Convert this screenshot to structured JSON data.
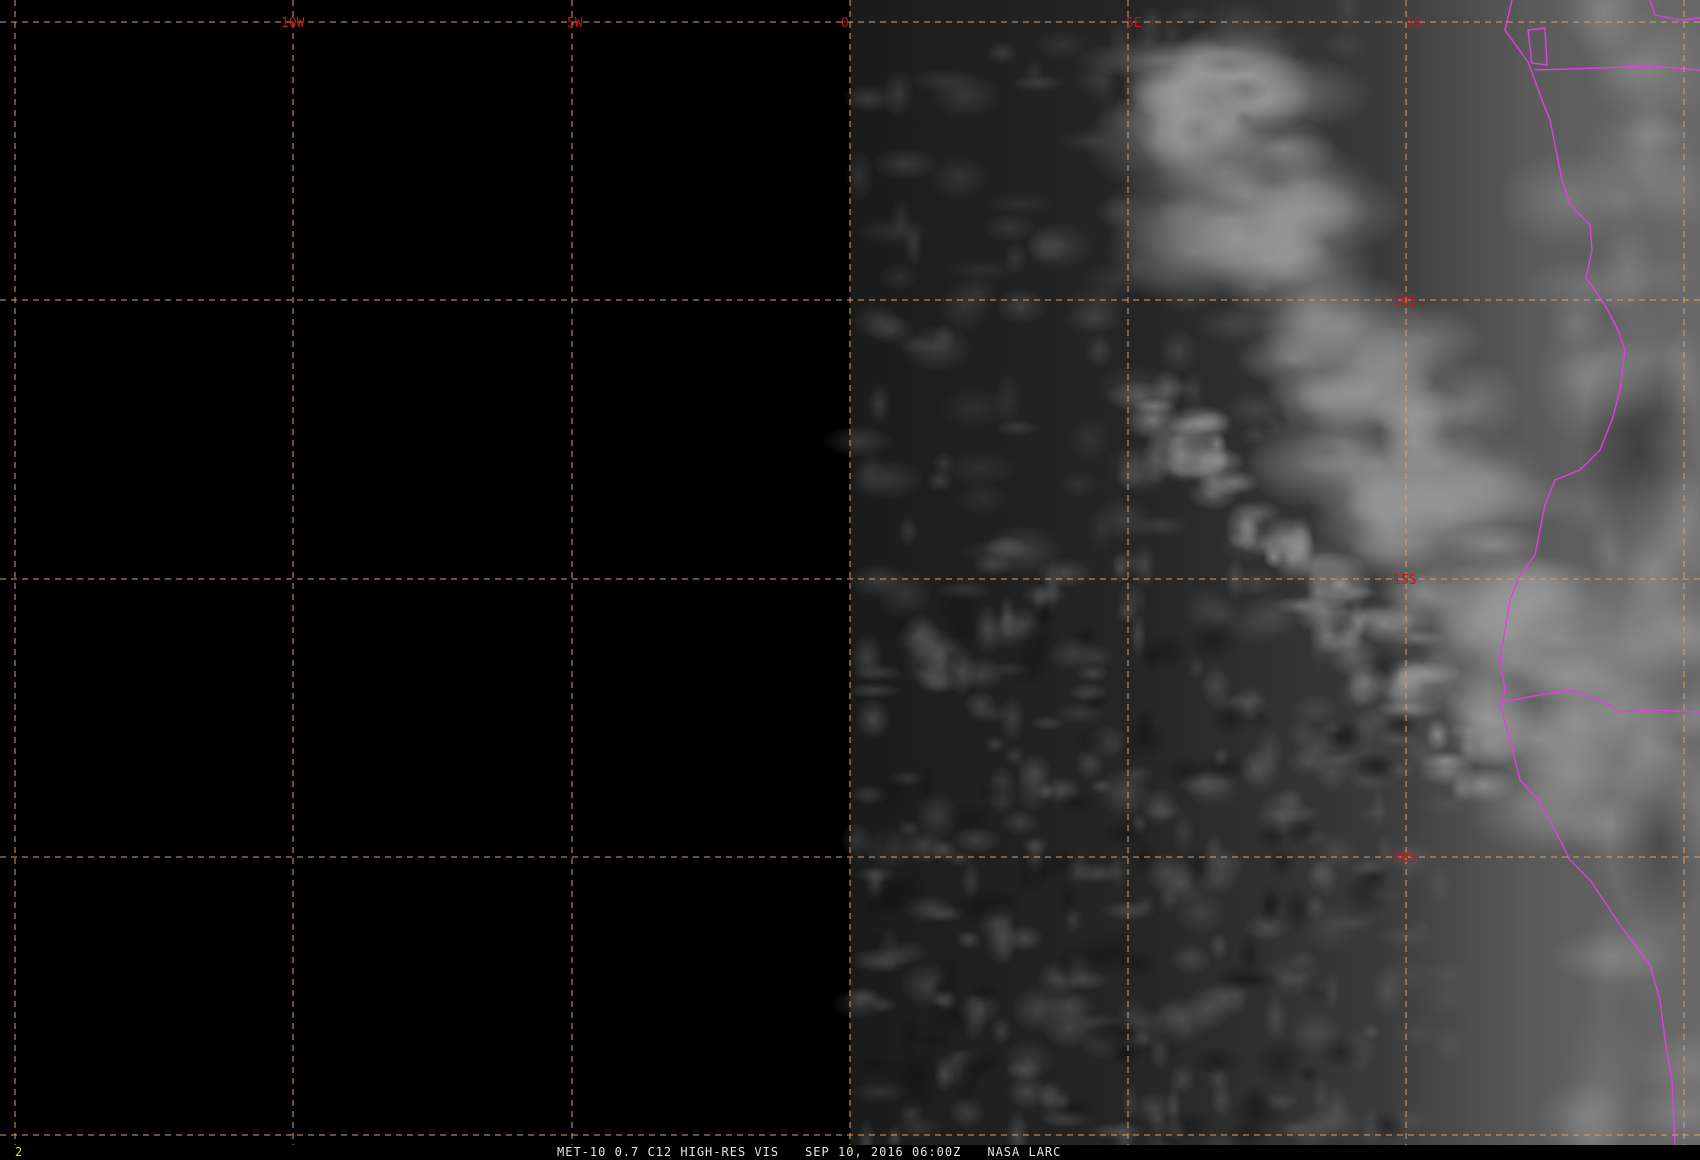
{
  "map": {
    "grid_color": "#d9a06a",
    "label_color": "#c21818",
    "border_color": "#e040e0",
    "longitude_labels": [
      "10W",
      "5W",
      "0",
      "5E",
      "5S"
    ],
    "latitude_labels": [
      "10S",
      "15S",
      "20S"
    ]
  },
  "status": {
    "frame_number": "2",
    "product": "MET-10 0.7 C12 HIGH-RES VIS",
    "datetime": "SEP 10, 2016 06:00Z",
    "source": "NASA LARC"
  }
}
